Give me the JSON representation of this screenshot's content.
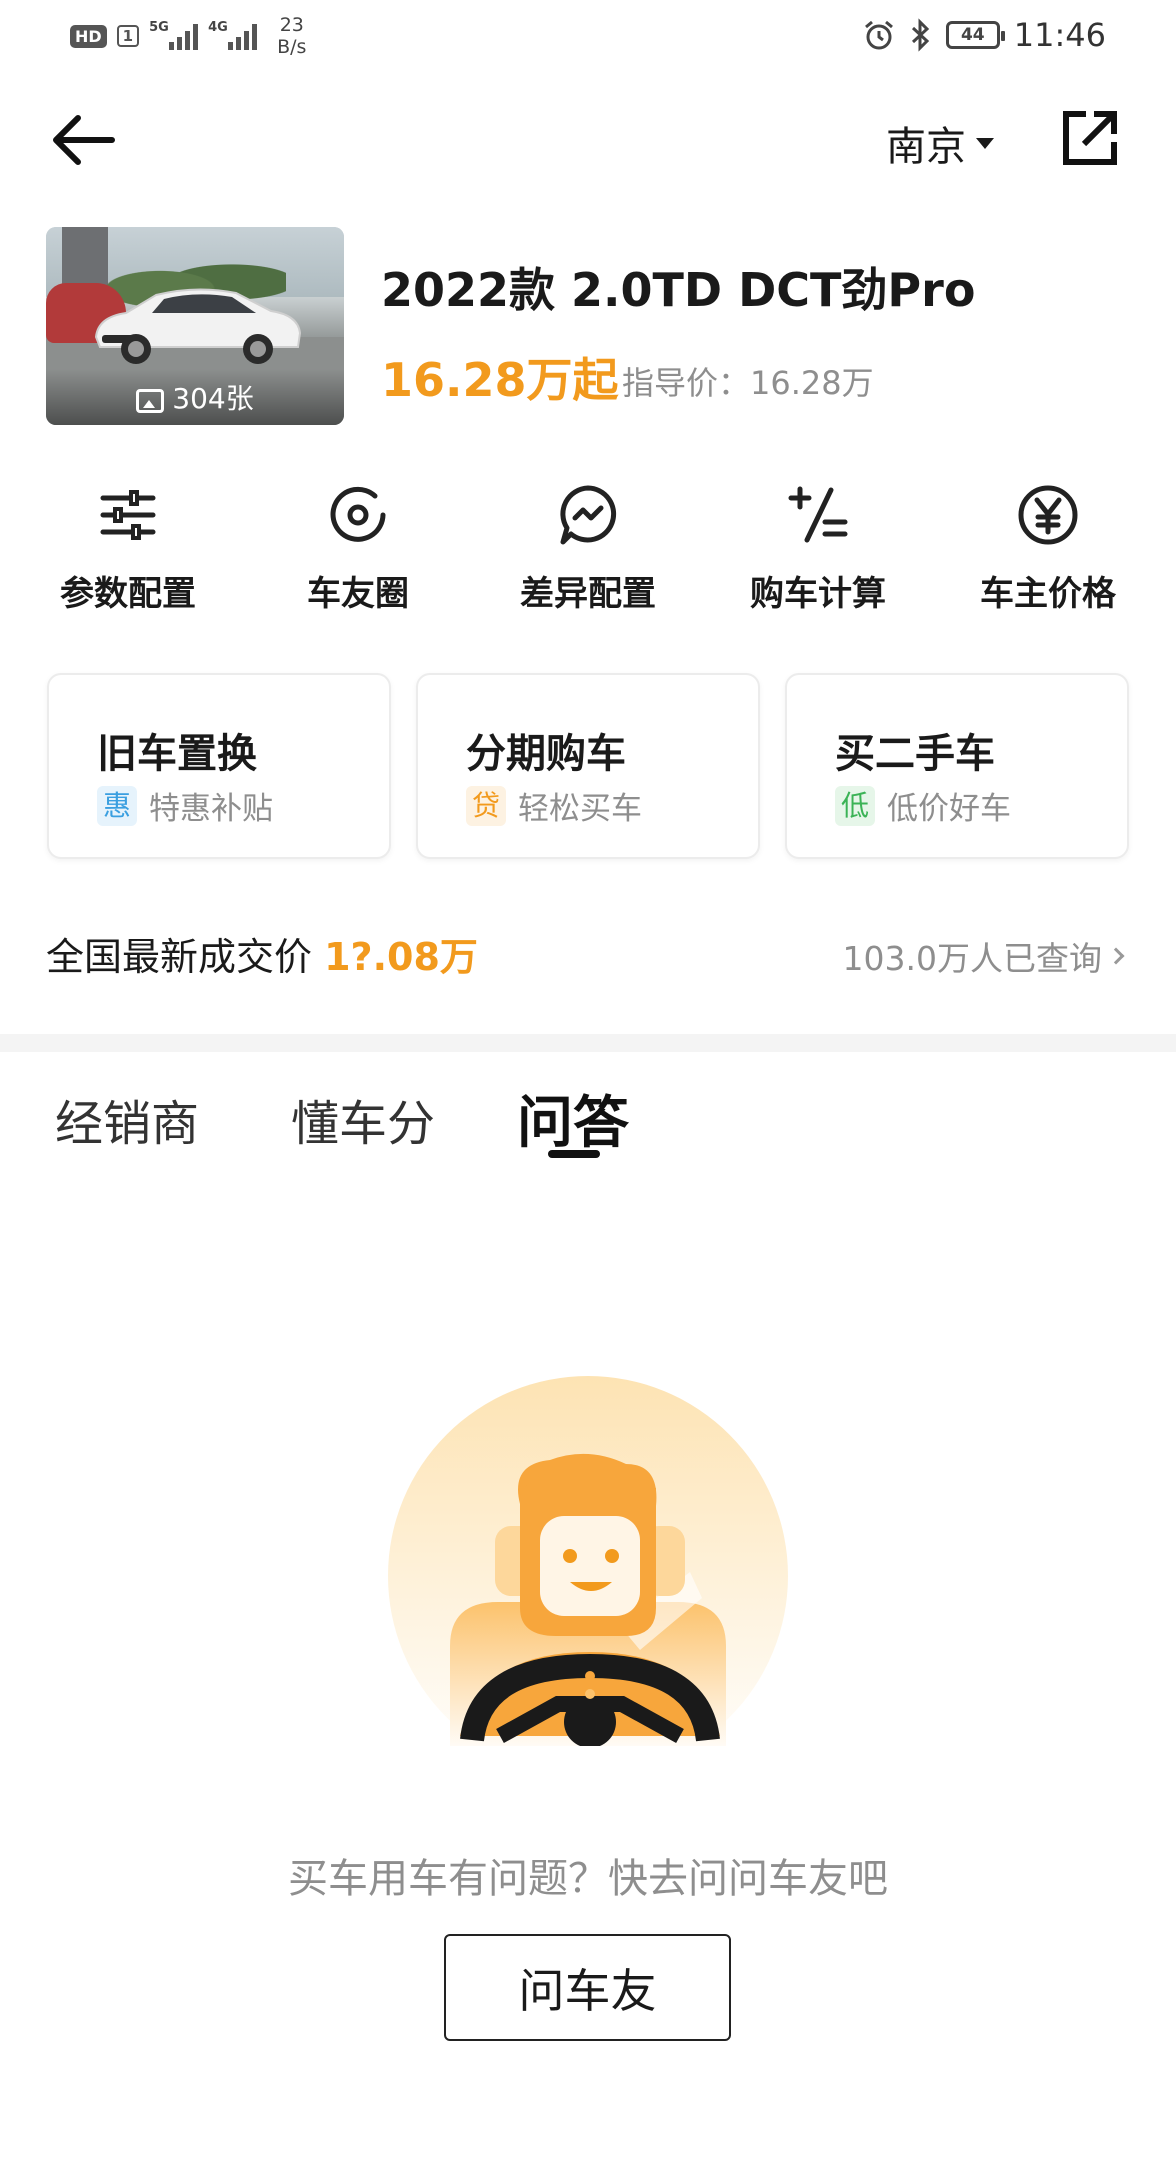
{
  "status_bar": {
    "hd": "HD",
    "sim": "1",
    "net1": "5G",
    "net2": "4G",
    "speed_value": "23",
    "speed_unit": "B/s",
    "battery": "44",
    "time": "11:46"
  },
  "header": {
    "city": "南京"
  },
  "car": {
    "photo_count": "304张",
    "title": "2022款 2.0TD DCT劲Pro",
    "price": "16.28万起",
    "guide_price": "指导价：16.28万"
  },
  "functions": [
    {
      "label": "参数配置",
      "icon": "sliders-icon"
    },
    {
      "label": "车友圈",
      "icon": "circle-target-icon"
    },
    {
      "label": "差异配置",
      "icon": "chat-bubble-icon"
    },
    {
      "label": "购车计算",
      "icon": "calculator-icon"
    },
    {
      "label": "车主价格",
      "icon": "yuan-icon"
    }
  ],
  "cards": [
    {
      "title": "旧车置换",
      "tag": "惠",
      "desc": "特惠补贴",
      "tag_color": "#3a9fe0",
      "tag_bg": "#e6f3fc"
    },
    {
      "title": "分期购车",
      "tag": "贷",
      "desc": "轻松买车",
      "tag_color": "#f29a1d",
      "tag_bg": "#fdf2e2"
    },
    {
      "title": "买二手车",
      "tag": "低",
      "desc": "低价好车",
      "tag_color": "#3bb356",
      "tag_bg": "#e6f6e9"
    }
  ],
  "latest": {
    "label": "全国最新成交价 ",
    "value": "1?.08万",
    "queries": "103.0万人已查询"
  },
  "tabs": [
    "经销商",
    "懂车分",
    "问答"
  ],
  "empty": {
    "text": "买车用车有问题？快去问问车友吧",
    "button": "问车友"
  },
  "colors": {
    "accent": "#f29a1d",
    "text_secondary": "#8e8e8e"
  }
}
